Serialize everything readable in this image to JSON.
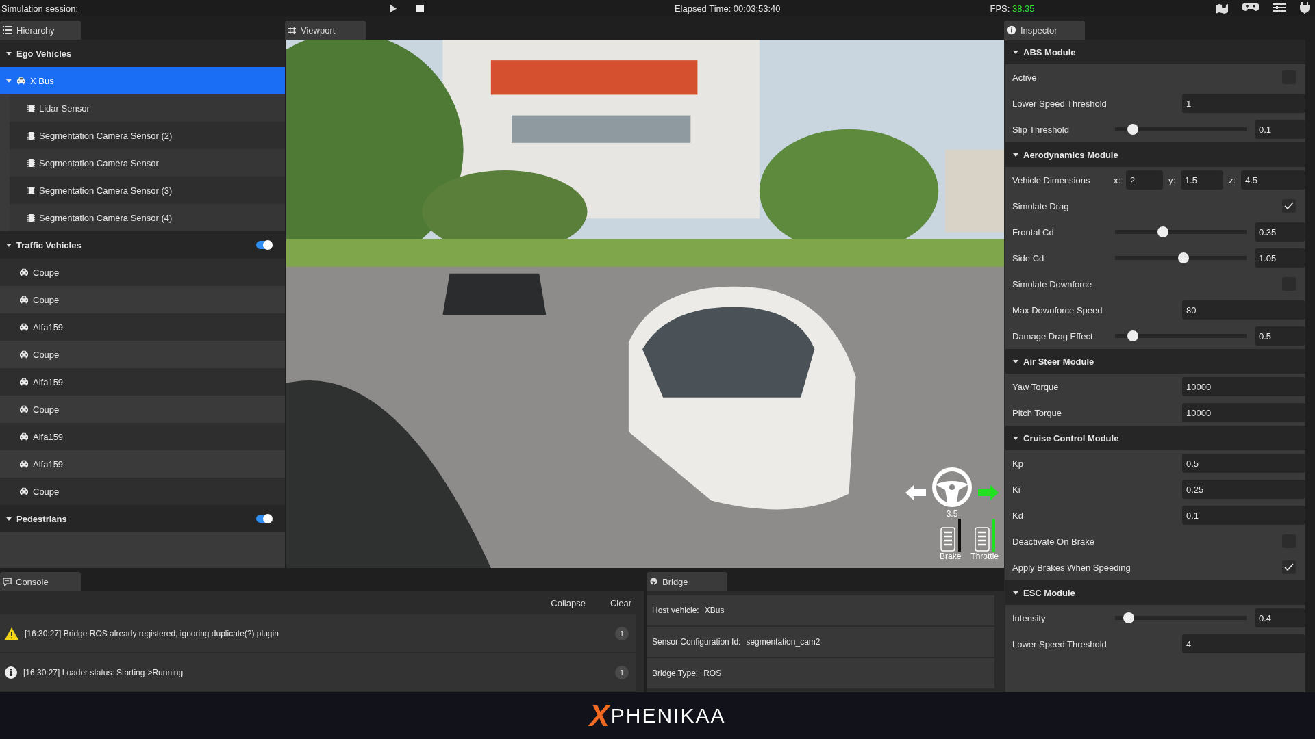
{
  "top_bar": {
    "title": "Simulation session:",
    "elapsed": "Elapsed Time: 00:03:53:40",
    "fps_label": "FPS:",
    "fps_value": "38.35"
  },
  "hierarchy": {
    "tab": "Hierarchy",
    "groups": [
      {
        "label": "Ego Vehicles",
        "expanded": true,
        "items": [
          {
            "kind": "vehicle",
            "label": "X Bus",
            "selected": true,
            "expanded": true,
            "children": [
              {
                "kind": "sensor",
                "label": "Lidar Sensor",
                "selected": false
              },
              {
                "kind": "sensor",
                "label": "Segmentation Camera Sensor (2)",
                "selected": false
              },
              {
                "kind": "sensor",
                "label": "Segmentation Camera Sensor",
                "selected": false
              },
              {
                "kind": "sensor",
                "label": "Segmentation Camera Sensor (3)",
                "selected": false
              },
              {
                "kind": "sensor",
                "label": "Segmentation Camera Sensor (4)",
                "selected": false
              }
            ]
          }
        ]
      },
      {
        "label": "Traffic Vehicles",
        "expanded": true,
        "toggle": {
          "on": true
        },
        "items": [
          {
            "kind": "vehicle",
            "label": "Coupe",
            "selected": false
          },
          {
            "kind": "vehicle",
            "label": "Coupe",
            "selected": false
          },
          {
            "kind": "vehicle",
            "label": "Alfa159",
            "selected": false
          },
          {
            "kind": "vehicle",
            "label": "Coupe",
            "selected": false
          },
          {
            "kind": "vehicle",
            "label": "Alfa159",
            "selected": false
          },
          {
            "kind": "vehicle",
            "label": "Coupe",
            "selected": false
          },
          {
            "kind": "vehicle",
            "label": "Alfa159",
            "selected": false
          },
          {
            "kind": "vehicle",
            "label": "Alfa159",
            "selected": false
          },
          {
            "kind": "vehicle",
            "label": "Coupe",
            "selected": false
          }
        ]
      },
      {
        "label": "Pedestrians",
        "expanded": true,
        "toggle": {
          "on": true
        }
      }
    ]
  },
  "viewport": {
    "tab": "Viewport",
    "hud": {
      "left_active": false,
      "right_active": true,
      "steering": "3.5",
      "brake": {
        "label": "Brake",
        "level": 0
      },
      "throttle": {
        "label": "Throttle",
        "level": 1
      }
    }
  },
  "inspector": {
    "tab": "Inspector",
    "sections": [
      {
        "title": "ABS Module",
        "expanded": true,
        "rows": [
          {
            "kind": "checkbox",
            "label": "Active",
            "checked": false
          },
          {
            "kind": "number",
            "label": "Lower Speed Threshold",
            "value": "1"
          },
          {
            "kind": "slider",
            "label": "Slip Threshold",
            "level": 0.1,
            "value": "0.1"
          }
        ]
      },
      {
        "title": "Aerodynamics Module",
        "expanded": true,
        "rows": [
          {
            "kind": "vector",
            "label": "Vehicle Dimensions",
            "parts": [
              {
                "axis": "x:",
                "value": "2"
              },
              {
                "axis": "y:",
                "value": "1.5"
              },
              {
                "axis": "z:",
                "value": "4.5"
              }
            ]
          },
          {
            "kind": "checkbox",
            "label": "Simulate Drag",
            "checked": true
          },
          {
            "kind": "slider",
            "label": "Frontal Cd",
            "level": 0.35,
            "value": "0.35"
          },
          {
            "kind": "slider",
            "label": "Side Cd",
            "level": 0.52,
            "value": "1.05"
          },
          {
            "kind": "checkbox",
            "label": "Simulate Downforce",
            "checked": false
          },
          {
            "kind": "number",
            "label": "Max Downforce Speed",
            "value": "80"
          },
          {
            "kind": "slider",
            "label": "Damage Drag Effect",
            "level": 0.1,
            "value": "0.5"
          }
        ]
      },
      {
        "title": "Air Steer Module",
        "expanded": true,
        "rows": [
          {
            "kind": "number",
            "label": "Yaw Torque",
            "value": "10000"
          },
          {
            "kind": "number",
            "label": "Pitch Torque",
            "value": "10000"
          }
        ]
      },
      {
        "title": "Cruise Control Module",
        "expanded": true,
        "rows": [
          {
            "kind": "number",
            "label": "Kp",
            "value": "0.5"
          },
          {
            "kind": "number",
            "label": "Ki",
            "value": "0.25"
          },
          {
            "kind": "number",
            "label": "Kd",
            "value": "0.1"
          },
          {
            "kind": "checkbox",
            "label": "Deactivate On Brake",
            "checked": false
          },
          {
            "kind": "checkbox",
            "label": "Apply Brakes When Speeding",
            "checked": true
          }
        ]
      },
      {
        "title": "ESC Module",
        "expanded": true,
        "rows": [
          {
            "kind": "slider",
            "label": "Intensity",
            "level": 0.07,
            "value": "0.4"
          },
          {
            "kind": "number",
            "label": "Lower Speed Threshold",
            "value": "4"
          }
        ]
      }
    ]
  },
  "console": {
    "tab": "Console",
    "buttons": [
      "Collapse",
      "Clear"
    ],
    "messages": [
      {
        "kind": "warning",
        "text": "[16:30:27] Bridge ROS already registered, ignoring duplicate(?) plugin",
        "count": "1"
      },
      {
        "kind": "info",
        "text": "[16:30:27] Loader status: Starting->Running",
        "count": "1"
      }
    ]
  },
  "bridge": {
    "tab": "Bridge",
    "fields": [
      {
        "label": "Host vehicle:",
        "value": "XBus"
      },
      {
        "label": "Sensor Configuration Id:",
        "value": "segmentation_cam2"
      },
      {
        "label": "Bridge Type:",
        "value": "ROS"
      }
    ]
  },
  "brand": {
    "mark": "X",
    "name": "PHENIKAA"
  }
}
